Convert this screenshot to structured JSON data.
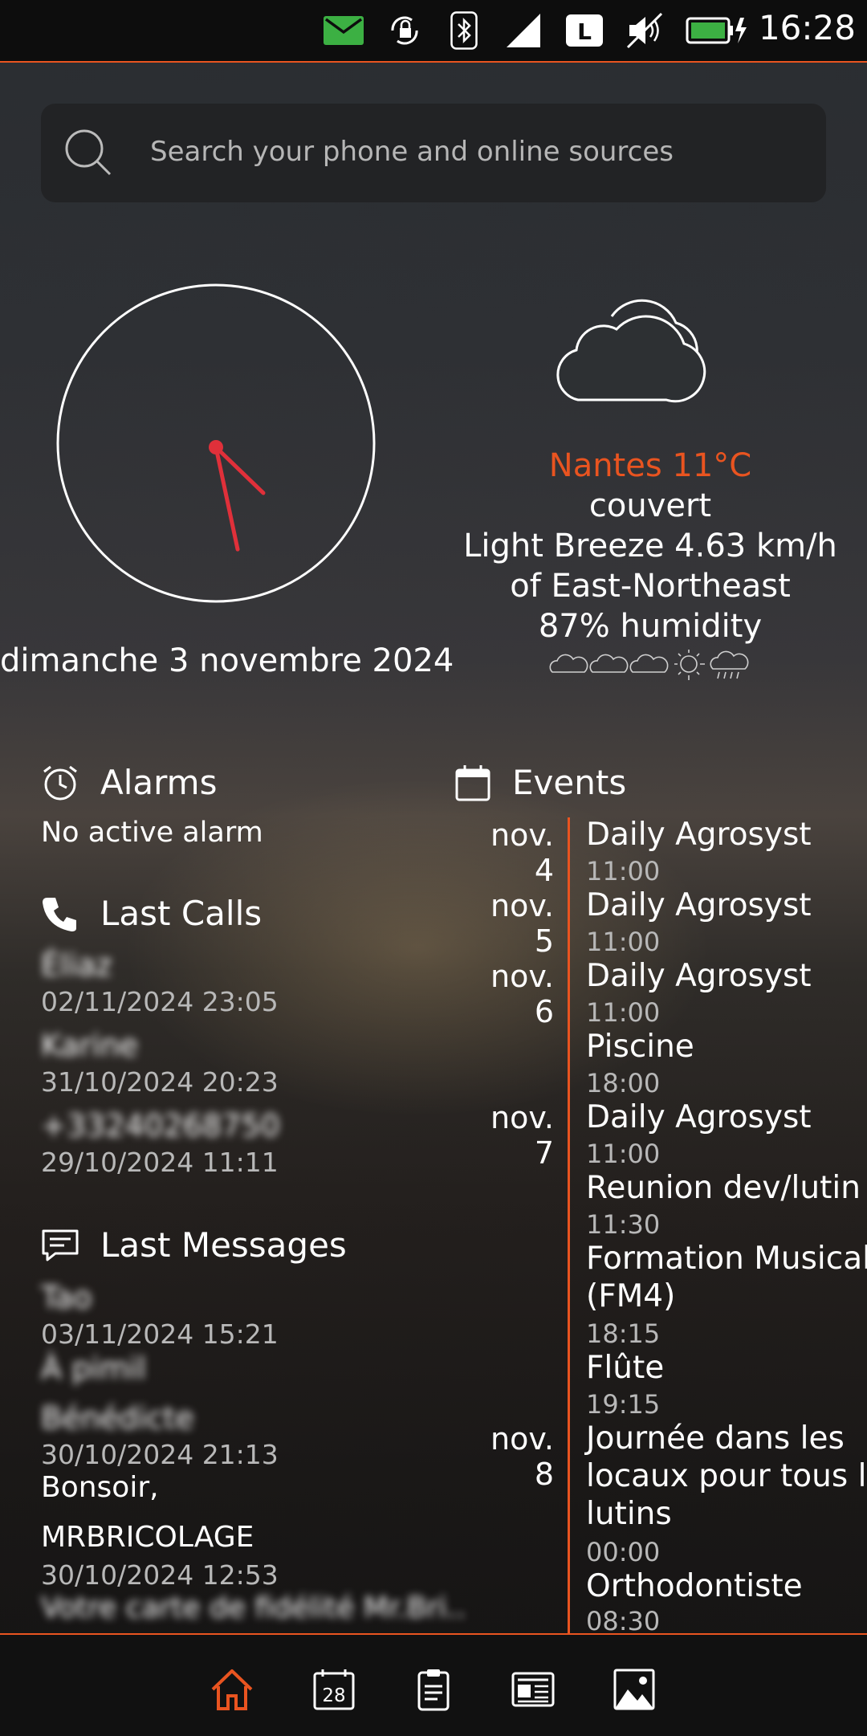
{
  "status_bar": {
    "time": "16:28",
    "icons": [
      "mail-icon",
      "rotation-lock-icon",
      "bluetooth-icon",
      "signal-icon",
      "lte-icon",
      "mute-icon",
      "battery-charging-icon"
    ],
    "network_label": "L"
  },
  "search": {
    "placeholder": "Search your phone and online sources"
  },
  "clock": {
    "hour": 4,
    "minute": 28,
    "date": "dimanche 3 novembre 2024"
  },
  "weather": {
    "city_temp": "Nantes 11°C",
    "condition": "couvert",
    "wind_line1": "Light Breeze 4.63 km/h",
    "wind_line2": "of East-Northeast",
    "humidity": "87% humidity",
    "forecast_icons": [
      "cloud-icon",
      "cloud-icon",
      "cloud-icon",
      "sun-icon",
      "rain-icon"
    ]
  },
  "alarms": {
    "title": "Alarms",
    "status": "No active alarm"
  },
  "last_calls": {
    "title": "Last Calls",
    "items": [
      {
        "name": "Éliaz",
        "time": "02/11/2024 23:05"
      },
      {
        "name": "Karine",
        "time": "31/10/2024 20:23"
      },
      {
        "name": "+33240268750",
        "time": "29/10/2024 11:11"
      }
    ]
  },
  "last_messages": {
    "title": "Last Messages",
    "items": [
      {
        "name": "Tao",
        "time": "03/11/2024 15:21",
        "text": "À pimil"
      },
      {
        "name": "Bénédicte",
        "time": "30/10/2024 21:13",
        "text": "Bonsoir,"
      },
      {
        "name": "MRBRICOLAGE",
        "time": "30/10/2024 12:53",
        "text": "Votre carte de fidélité Mr.Bri…"
      }
    ]
  },
  "events": {
    "title": "Events",
    "dates": [
      "nov. 4",
      "nov. 5",
      "nov. 6",
      "nov. 7",
      "nov. 8"
    ],
    "items": [
      {
        "title": "Daily Agrosyst",
        "time": "11:00"
      },
      {
        "title": "Daily Agrosyst",
        "time": "11:00"
      },
      {
        "title": "Daily Agrosyst",
        "time": "11:00"
      },
      {
        "title": "Piscine",
        "time": "18:00"
      },
      {
        "title": "Daily Agrosyst",
        "time": "11:00"
      },
      {
        "title": "Reunion dev/lutin",
        "time": "11:30"
      },
      {
        "title_line1": "Formation Musicale",
        "title_line2": "(FM4)",
        "time": "18:15"
      },
      {
        "title": "Flûte",
        "time": "19:15"
      },
      {
        "title_line1": "Journée dans les",
        "title_line2": "locaux pour tous les",
        "title_line3": "lutins",
        "time": "00:00"
      },
      {
        "title": "Orthodontiste",
        "time": "08:30"
      }
    ]
  },
  "bottom_nav": {
    "active": "home",
    "calendar_day": "28",
    "items": [
      "home-icon",
      "calendar-icon",
      "clipboard-icon",
      "news-icon",
      "gallery-icon"
    ]
  },
  "colors": {
    "accent": "#e95420",
    "clock_hands": "#e0303a",
    "status_mail": "#3cb043",
    "battery": "#3cb043"
  }
}
